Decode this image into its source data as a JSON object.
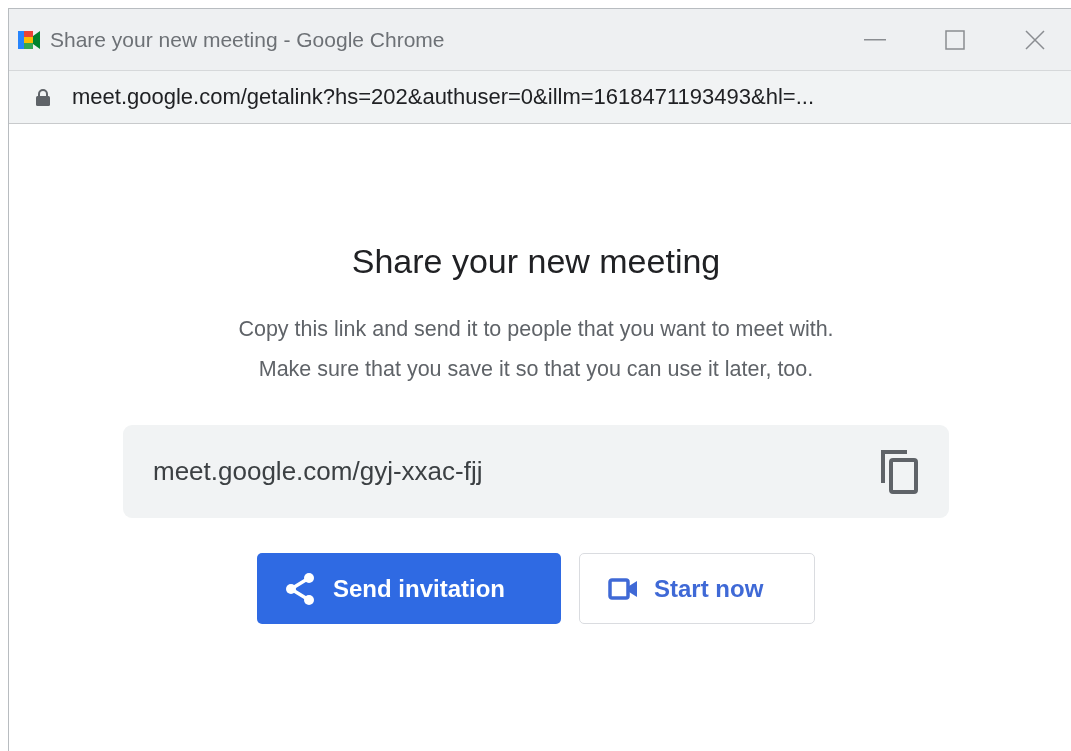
{
  "window": {
    "title": "Share your new meeting - Google Chrome"
  },
  "address_bar": {
    "url": "meet.google.com/getalink?hs=202&authuser=0&illm=1618471193493&hl=..."
  },
  "dialog": {
    "heading": "Share your new meeting",
    "description": [
      "Copy this link and send it to people that you want to meet with.",
      "Make sure that you save it so that you can use it later, too."
    ],
    "link": "meet.google.com/gyj-xxac-fjj",
    "buttons": [
      {
        "kind": "primary",
        "label": "Send invitation"
      },
      {
        "kind": "outlined",
        "label": "Start now"
      }
    ]
  }
}
